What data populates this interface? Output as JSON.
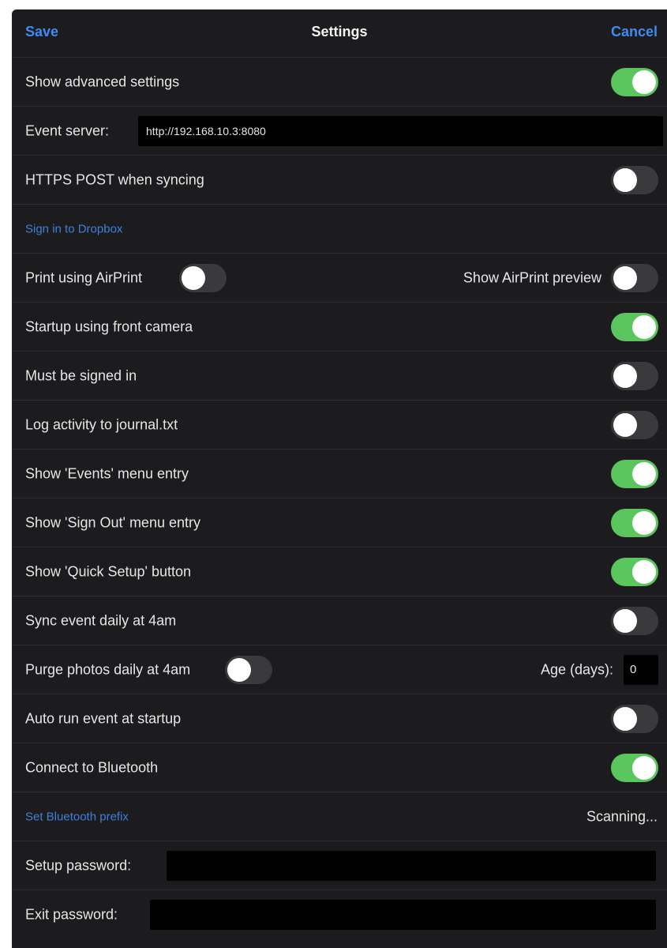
{
  "header": {
    "save_label": "Save",
    "title": "Settings",
    "cancel_label": "Cancel"
  },
  "rows": {
    "advanced": {
      "label": "Show advanced settings",
      "on": true
    },
    "event_server": {
      "label": "Event server:",
      "value": "http://192.168.10.3:8080"
    },
    "https_post": {
      "label": "HTTPS POST when syncing",
      "on": false
    },
    "dropbox": {
      "label": "Sign in to Dropbox"
    },
    "airprint": {
      "label": "Print using AirPrint",
      "on": false,
      "preview_label": "Show AirPrint preview",
      "preview_on": false
    },
    "front_camera": {
      "label": "Startup using front camera",
      "on": true
    },
    "signed_in": {
      "label": "Must be signed in",
      "on": false
    },
    "log_activity": {
      "label": "Log activity to journal.txt",
      "on": false
    },
    "events_menu": {
      "label": "Show 'Events' menu entry",
      "on": true
    },
    "signout_menu": {
      "label": "Show 'Sign Out' menu entry",
      "on": true
    },
    "quick_setup": {
      "label": "Show 'Quick Setup' button",
      "on": true
    },
    "sync_daily": {
      "label": "Sync event daily at 4am",
      "on": false
    },
    "purge_photos": {
      "label": "Purge photos daily at 4am",
      "on": false,
      "age_label": "Age (days):",
      "age_value": "0"
    },
    "auto_run": {
      "label": "Auto run event at startup",
      "on": false
    },
    "bluetooth": {
      "label": "Connect to Bluetooth",
      "on": true
    },
    "bt_prefix": {
      "label": "Set Bluetooth prefix",
      "status": "Scanning..."
    },
    "setup_password": {
      "label": "Setup password:",
      "value": ""
    },
    "exit_password": {
      "label": "Exit password:",
      "value": ""
    }
  },
  "colors": {
    "accent": "#3f8cf0",
    "toggle_on": "#5cc65e",
    "toggle_off": "#3a3a3c",
    "background": "#1c1c1e"
  }
}
